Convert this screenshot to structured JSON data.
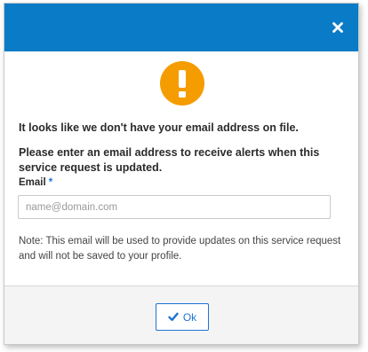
{
  "dialog": {
    "close_icon": "close-icon",
    "warning_icon": "exclamation-circle-icon",
    "message_line1": "It looks like we don't have your email address on file.",
    "message_line2": "Please enter an email address to receive alerts when this service request is updated.",
    "email": {
      "label": "Email",
      "required_marker": "*",
      "placeholder": "name@domain.com",
      "value": ""
    },
    "note": "Note: This email will be used to provide updates on this service request and will not be saved to your profile.",
    "ok_button": {
      "icon": "check-icon",
      "label": "Ok"
    }
  },
  "colors": {
    "header": "#0a7bc6",
    "warning": "#f59c00",
    "accent": "#1f73d6"
  }
}
